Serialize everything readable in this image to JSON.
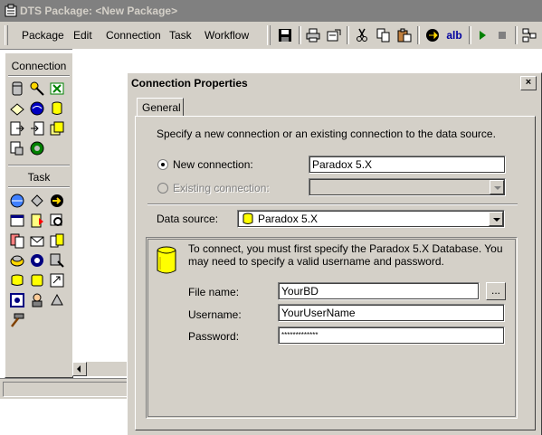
{
  "window": {
    "title": "DTS Package: <New Package>"
  },
  "menu": [
    "Package",
    "Edit",
    "Connection",
    "Task",
    "Workflow"
  ],
  "toolbar": {
    "buttons": [
      "save-icon",
      "print-icon",
      "print-setup-icon",
      "cut-icon",
      "copy-icon",
      "paste-icon",
      "transform-icon",
      "text-annotation-icon",
      "run-icon",
      "stop-icon",
      "layout-icon"
    ],
    "text_annotation_label": "alb"
  },
  "palette": {
    "connection_label": "Connection",
    "task_label": "Task"
  },
  "dialog": {
    "title": "Connection Properties",
    "close_label": "×",
    "tab_label": "General",
    "intro_text": "Specify a new connection or an existing connection to the data source.",
    "new_connection_label": "New connection:",
    "new_connection_value": "Paradox 5.X",
    "existing_connection_label": "Existing connection:",
    "existing_connection_value": "",
    "data_source_label": "Data source:",
    "data_source_value": "Paradox 5.X",
    "info_text": "To connect, you must first specify the Paradox 5.X Database.  You may need to specify a valid username and password.",
    "file_name_label": "File name:",
    "file_name_value": "YourBD",
    "browse_label": "...",
    "username_label": "Username:",
    "username_value": "YourUserName",
    "password_label": "Password:",
    "password_value": "*************"
  }
}
